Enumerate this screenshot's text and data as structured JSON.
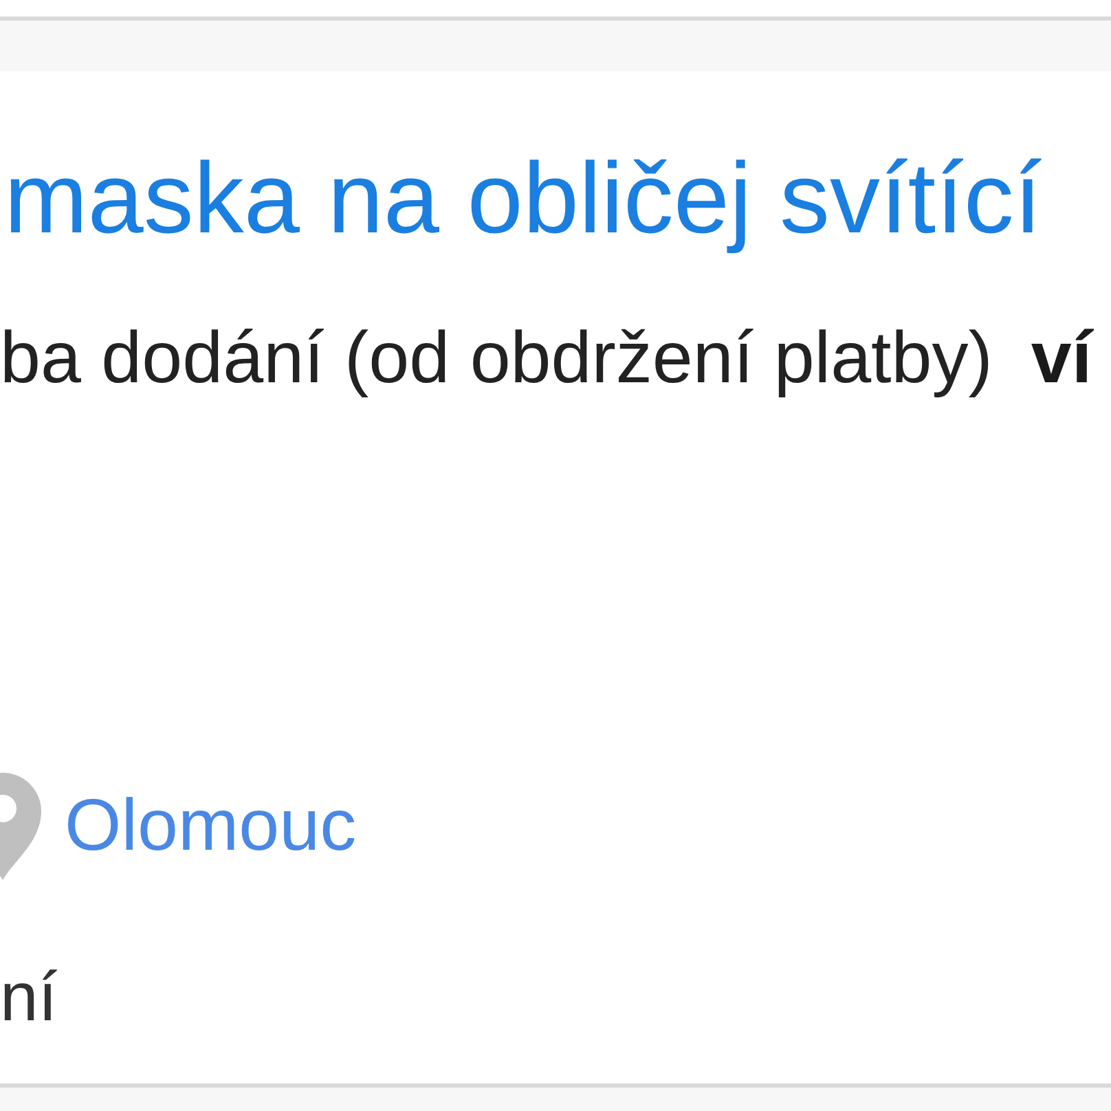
{
  "title": "maska na obličej svítící",
  "delivery": {
    "text": "ba dodání (od obdržení platby)",
    "more_link": "ví"
  },
  "location": {
    "city": "Olomouc"
  },
  "note": "ní"
}
